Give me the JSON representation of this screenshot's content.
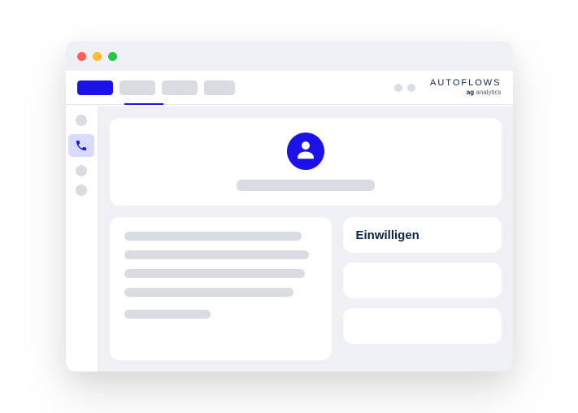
{
  "brand": {
    "line1": "AUTOFLOWS",
    "line2_bold": "ag",
    "line2_rest": " analytics"
  },
  "right_panel": {
    "consent_label": "Einwilligen"
  },
  "icons": {
    "phone": "phone-icon",
    "avatar": "person-icon"
  }
}
